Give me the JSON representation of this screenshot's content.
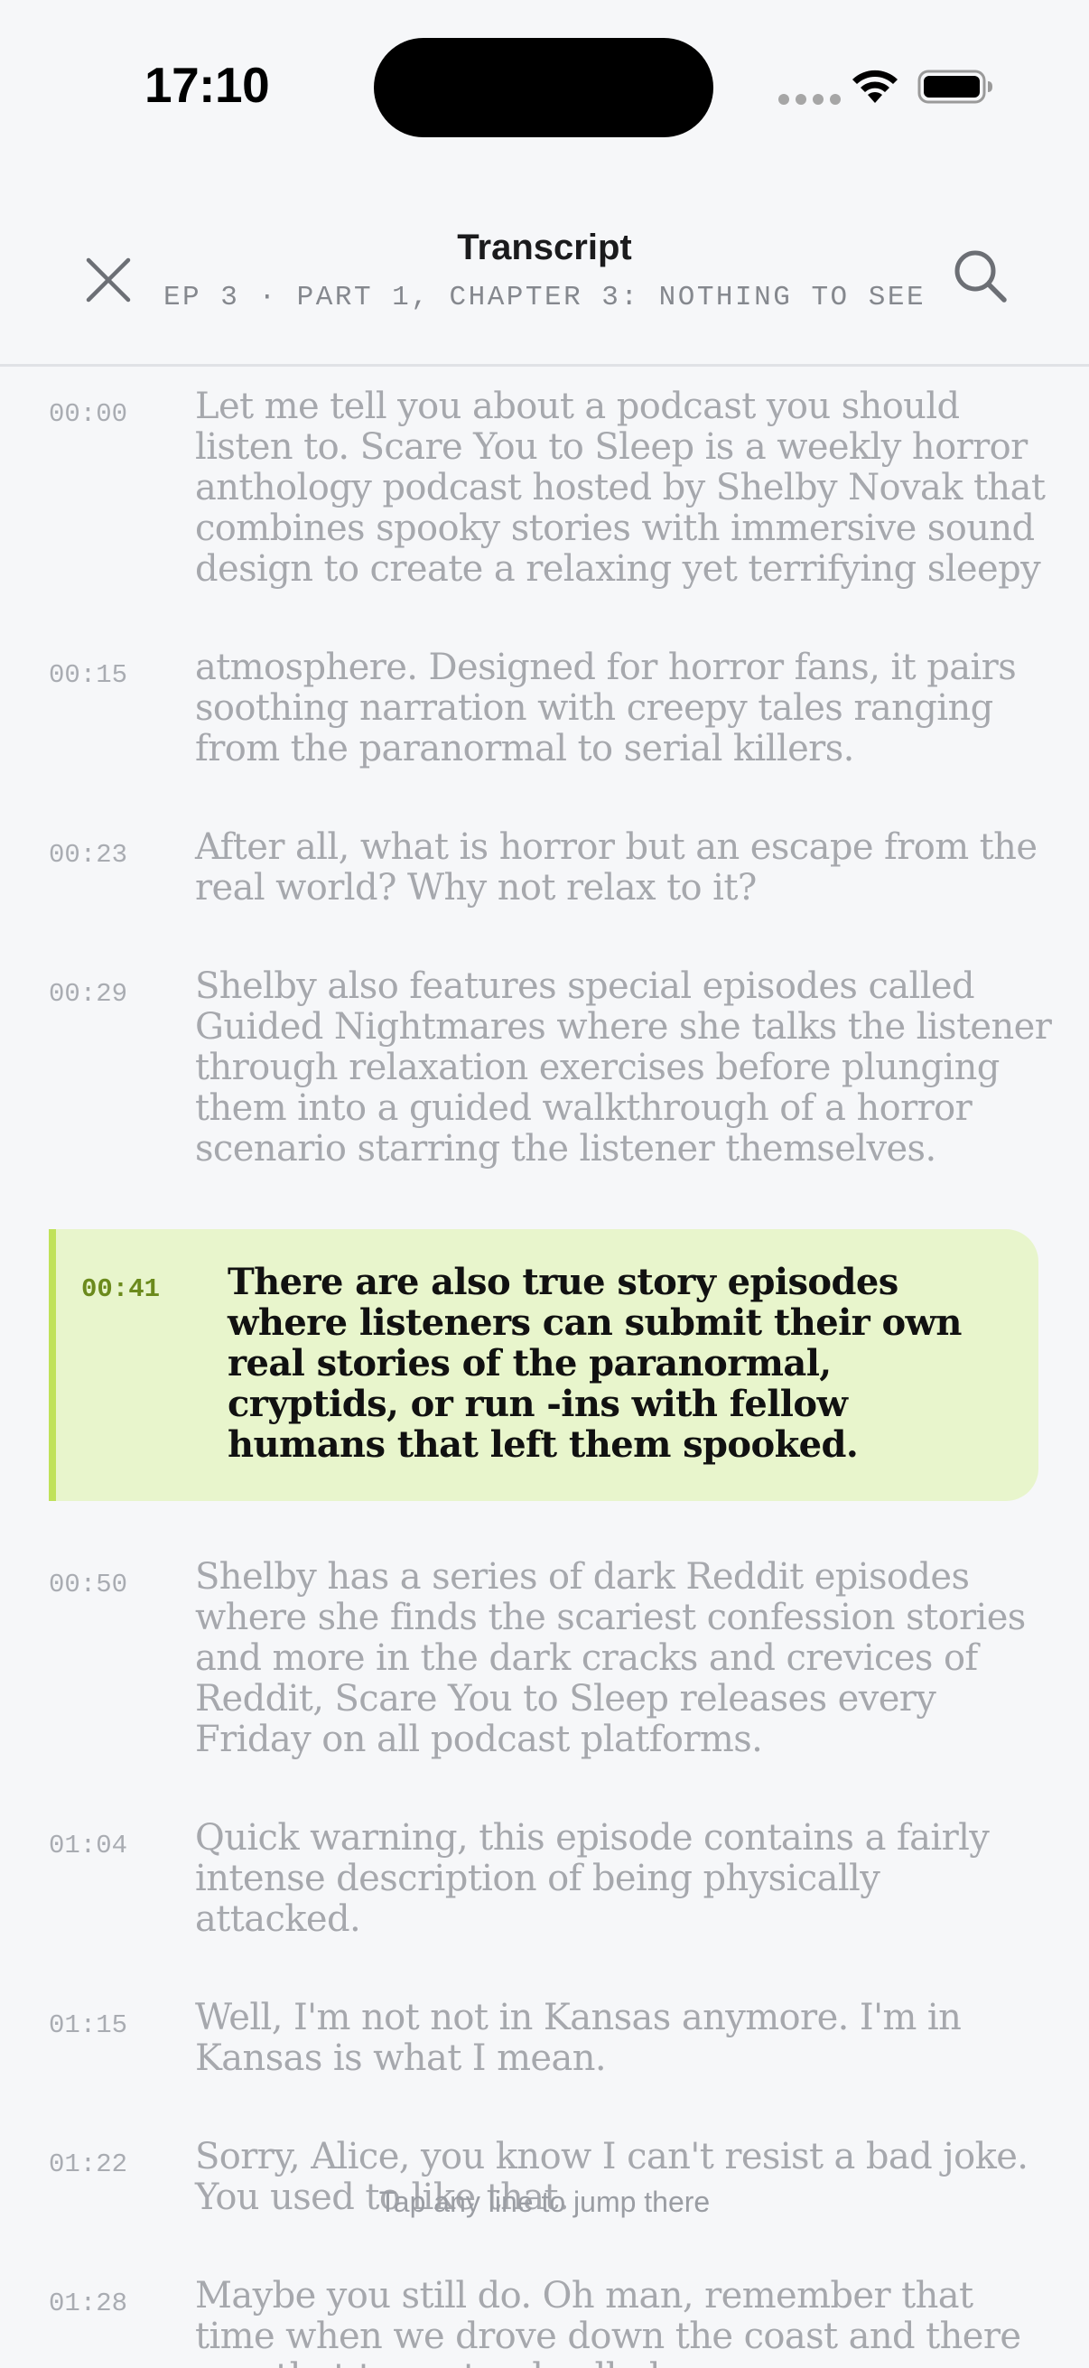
{
  "status_bar": {
    "time": "17:10"
  },
  "header": {
    "title": "Transcript",
    "subtitle": "EP 3 · PART 1, CHAPTER 3: NOTHING TO SEE",
    "close_icon": "close-icon",
    "search_icon": "search-icon"
  },
  "transcript": {
    "active_index": 4,
    "accent_color": "#c0e25a",
    "lines": [
      {
        "time": "00:00",
        "text": "Let me tell you about a podcast you should listen to. Scare You to Sleep is a weekly horror anthology podcast hosted by Shelby Novak that combines spooky stories with immersive sound design to create a relaxing yet terrifying sleepy"
      },
      {
        "time": "00:15",
        "text": "atmosphere. Designed for horror fans, it pairs soothing narration with creepy tales ranging from the paranormal to serial killers."
      },
      {
        "time": "00:23",
        "text": "After all, what is horror but an escape from the real world? Why not relax to it?"
      },
      {
        "time": "00:29",
        "text": "Shelby also features special episodes called Guided Nightmares where she talks the listener through relaxation exercises before plunging them into a guided walkthrough of a horror scenario starring the listener themselves."
      },
      {
        "time": "00:41",
        "text": "There are also true story episodes where listeners can submit their own real stories of the paranormal, cryptids, or run -ins with fellow humans that left them spooked."
      },
      {
        "time": "00:50",
        "text": "Shelby has a series of dark Reddit episodes where she finds the scariest confession stories and more in the dark cracks and crevices of Reddit, Scare You to Sleep releases every Friday on all podcast platforms."
      },
      {
        "time": "01:04",
        "text": "Quick warning, this episode contains a fairly intense description of being physically attacked."
      },
      {
        "time": "01:15",
        "text": "Well, I'm not not in Kansas anymore. I'm in Kansas is what I mean."
      },
      {
        "time": "01:22",
        "text": "Sorry, Alice, you know I can't resist a bad joke. You used to like that."
      },
      {
        "time": "01:28",
        "text": "Maybe you still do. Oh man, remember that time when we drove down the coast and there was that taco stand called..."
      }
    ]
  },
  "footer": {
    "hint": "Tap any line to jump there"
  }
}
